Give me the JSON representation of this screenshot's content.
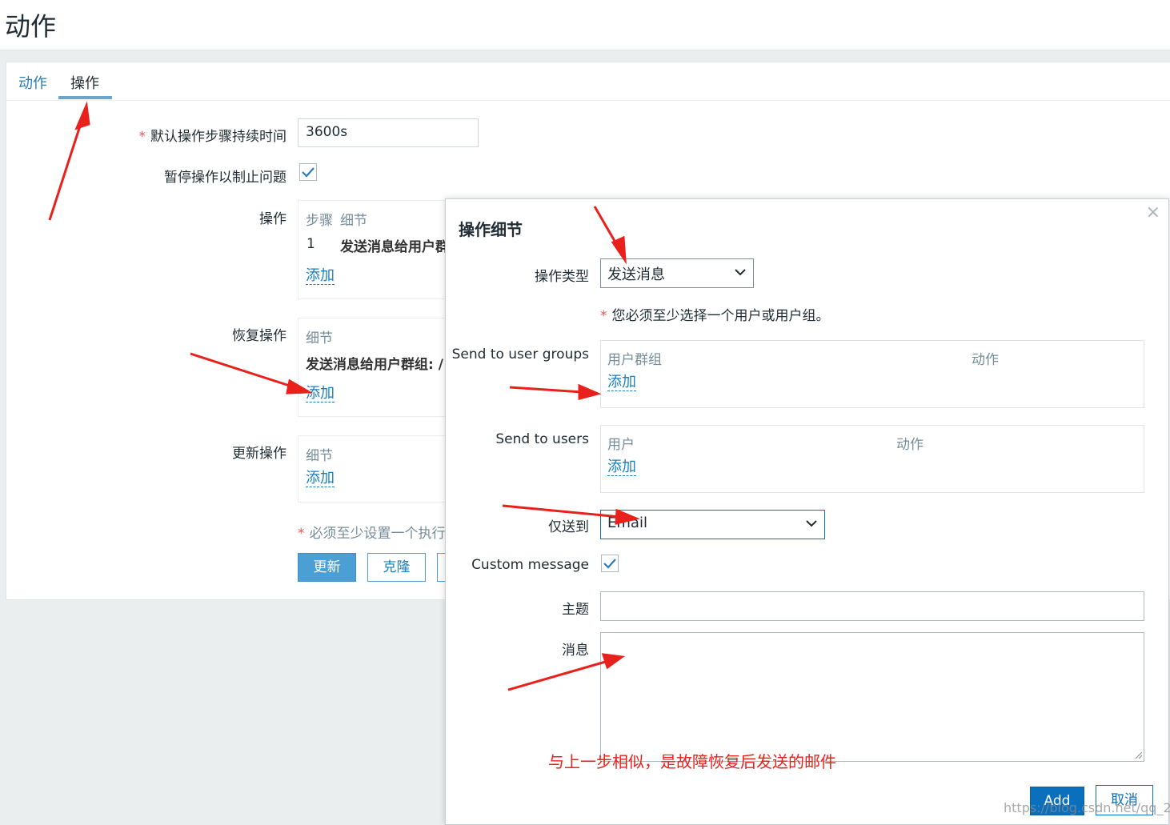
{
  "page": {
    "title": "动作"
  },
  "tabs": [
    {
      "label": "动作",
      "active": false
    },
    {
      "label": "操作",
      "active": true
    }
  ],
  "form": {
    "default_step_duration": {
      "label": "默认操作步骤持续时间",
      "value": "3600s"
    },
    "pause_label": "暂停操作以制止问题",
    "pause_checked": true,
    "operations": {
      "label": "操作",
      "col_steps": "步骤",
      "col_details": "细节",
      "rows": [
        {
          "step": "1",
          "detail": "发送消息给用户群"
        }
      ],
      "add": "添加"
    },
    "recovery": {
      "label": "恢复操作",
      "col_details": "细节",
      "row": "发送消息给用户群组: /",
      "add": "添加"
    },
    "update": {
      "label": "更新操作",
      "col_details": "细节",
      "add": "添加"
    },
    "note": "必须至少设置一个执行",
    "buttons": {
      "update": "更新",
      "clone": "克隆"
    }
  },
  "dialog": {
    "title": "操作细节",
    "close": "×",
    "operation_type": {
      "label": "操作类型",
      "value": "发送消息"
    },
    "warning": "您必须至少选择一个用户或用户组。",
    "user_groups": {
      "label": "Send to user groups",
      "col1": "用户群组",
      "col2": "动作",
      "add": "添加"
    },
    "users": {
      "label": "Send to users",
      "col1": "用户",
      "col2": "动作",
      "add": "添加"
    },
    "send_only_to": {
      "label": "仅送到",
      "value": "Email"
    },
    "custom_message": {
      "label": "Custom message",
      "checked": true
    },
    "subject": {
      "label": "主题",
      "value": ""
    },
    "message": {
      "label": "消息",
      "value": ""
    },
    "buttons": {
      "add": "Add",
      "cancel": "取消"
    }
  },
  "annotation": "与上一步相似，是故障恢复后发送的邮件",
  "watermark": "https://blog.csdn.net/qq_2..."
}
